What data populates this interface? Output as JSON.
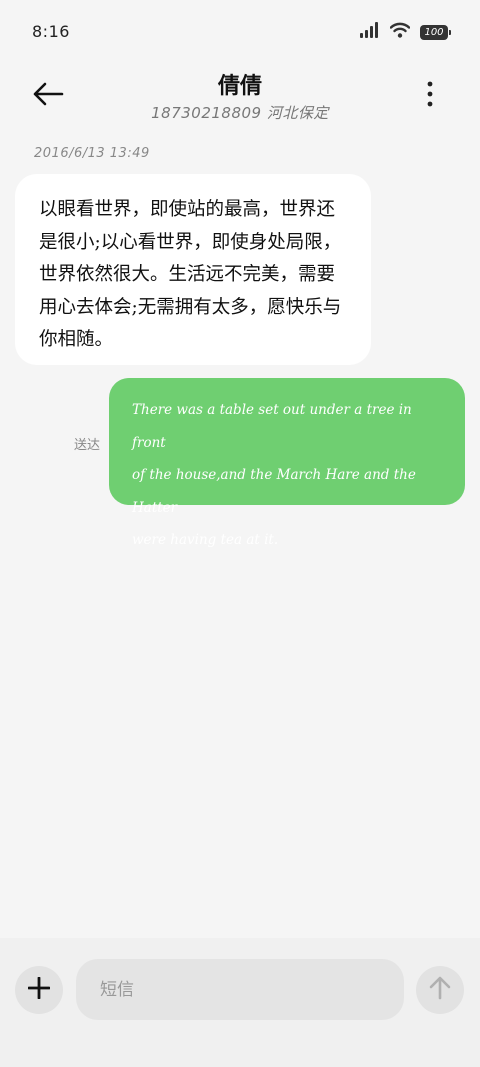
{
  "status_bar": {
    "time": "8:16",
    "battery": "100",
    "icons": [
      "signal-icon",
      "wifi-icon",
      "battery-icon"
    ]
  },
  "header": {
    "contact_name": "倩倩",
    "contact_subtitle": "18730218809 河北保定",
    "back_icon": "arrow-left-icon",
    "more_icon": "more-vertical-icon"
  },
  "conversation": {
    "timestamp": "2016/6/13 13:49",
    "incoming": {
      "lines": [
        "以眼看世界，即使站的最高，世界还",
        "是很小;以心看世界，即使身处局限，",
        "世界依然很大。生活远不完美，需要",
        "用心去体会;无需拥有太多，愿快乐与",
        "你相随。"
      ]
    },
    "outgoing": {
      "lines": [
        "There was a table set out under a tree in front",
        "of the house,and the March Hare and the Hatter",
        "were having tea at it."
      ],
      "status": "送达"
    }
  },
  "composer": {
    "placeholder": "短信",
    "add_icon": "plus-icon",
    "send_icon": "arrow-up-icon"
  },
  "colors": {
    "background": "#f5f5f5",
    "incoming_bubble": "#ffffff",
    "outgoing_bubble": "#6fcf71",
    "input_background": "#e4e4e4"
  }
}
